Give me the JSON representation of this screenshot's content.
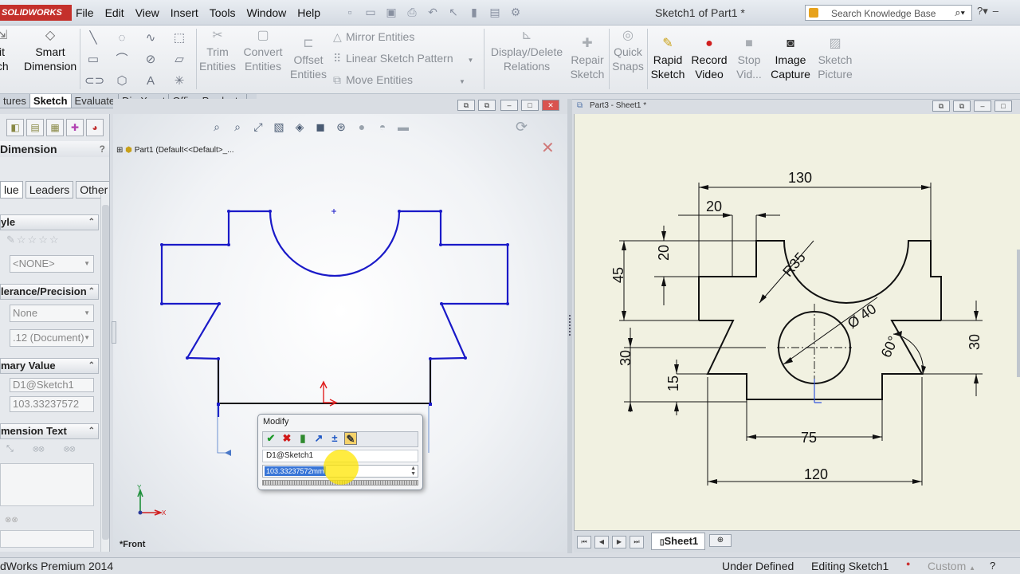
{
  "titlebar": {
    "logo_text": "SOLIDWORKS",
    "menu": [
      "File",
      "Edit",
      "View",
      "Insert",
      "Tools",
      "Window",
      "Help"
    ],
    "doc_title": "Sketch1 of Part1 *",
    "search_placeholder": "Search Knowledge Base"
  },
  "ribbon": {
    "exit_sketch": [
      "xit",
      "tch"
    ],
    "smart_dimension": [
      "Smart",
      "Dimension"
    ],
    "trim_entities": [
      "Trim",
      "Entities"
    ],
    "convert_entities": [
      "Convert",
      "Entities"
    ],
    "offset_entities": [
      "Offset",
      "Entities"
    ],
    "mirror_entities": "Mirror Entities",
    "linear_pattern": "Linear Sketch Pattern",
    "move_entities": "Move Entities",
    "display_delete_relations": [
      "Display/Delete",
      "Relations"
    ],
    "repair_sketch": [
      "Repair",
      "Sketch"
    ],
    "quick_snaps": [
      "Quick",
      "Snaps"
    ],
    "rapid_sketch": [
      "Rapid",
      "Sketch"
    ],
    "record_video": [
      "Record",
      "Video"
    ],
    "stop_video": [
      "Stop",
      "Vid..."
    ],
    "image_capture": [
      "Image",
      "Capture"
    ],
    "sketch_picture": [
      "Sketch",
      "Picture"
    ]
  },
  "tabs": [
    "tures",
    "Sketch",
    "Evaluate",
    "DimXpert",
    "Office Products"
  ],
  "property_manager": {
    "title": "Dimension",
    "subtabs": [
      "lue",
      "Leaders",
      "Other"
    ],
    "style_group": "yle",
    "style_value": "<NONE>",
    "tolerance_group": "lerance/Precision",
    "tolerance_value": "None",
    "precision_value": ".12 (Document)",
    "primary_group": "mary Value",
    "primary_name": "D1@Sketch1",
    "primary_value": "103.33237572",
    "dimtext_group": "mension Text"
  },
  "viewport": {
    "tree_node": "Part1  (Default<<Default>_...",
    "view_label": "*Front",
    "axis_y": "Y",
    "axis_x": "X"
  },
  "modify": {
    "title": "Modify",
    "dimension_name": "D1@Sketch1",
    "value": "103.33237572mm"
  },
  "drawing": {
    "window_title": "Part3 - Sheet1 *",
    "sheet_tab": "Sheet1",
    "dims": {
      "d130": "130",
      "d20_top": "20",
      "d45": "45",
      "d20_side": "20",
      "r35": "R35",
      "d40": "Ø 40",
      "a60": "60°",
      "d30_left": "30",
      "d30_right": "30",
      "d15": "15",
      "d75": "75",
      "d120": "120"
    }
  },
  "statusbar": {
    "app": "dWorks Premium 2014",
    "definition": "Under Defined",
    "editing": "Editing Sketch1",
    "units": "Custom",
    "help": "?"
  },
  "colors": {
    "sketch_blue": "#1a1ac8",
    "sketch_black": "#111111",
    "drawing_line": "#111111",
    "sheet_bg": "#f1f1e1"
  }
}
